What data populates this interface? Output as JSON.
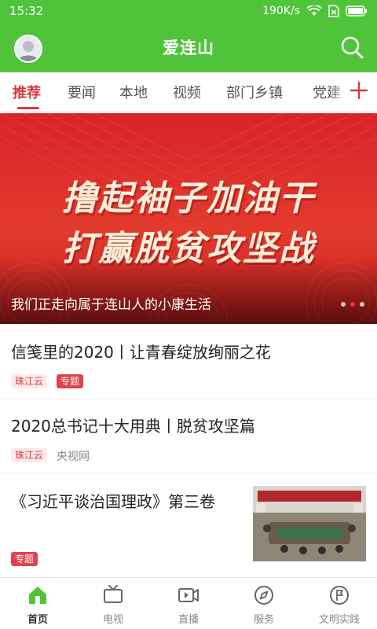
{
  "status_bar": {
    "time": "15:32",
    "speed": "190K/s"
  },
  "header": {
    "title": "爱连山"
  },
  "tabs": [
    {
      "label": "推荐",
      "active": true
    },
    {
      "label": "要闻"
    },
    {
      "label": "本地"
    },
    {
      "label": "视频"
    },
    {
      "label": "部门乡镇"
    },
    {
      "label": "党建"
    }
  ],
  "banner": {
    "headline_line1": "撸起袖子加油干",
    "headline_line2": "打赢脱贫攻坚战",
    "caption": "我们正走向属于连山人的小康生活",
    "pages": 3,
    "active_page": 2
  },
  "news": [
    {
      "title": "信笺里的2020丨让青春绽放绚丽之花",
      "source": "珠江云",
      "tag": "专题"
    },
    {
      "title": "2020总书记十大用典丨脱贫攻坚篇",
      "source": "珠江云",
      "publisher": "央视网"
    },
    {
      "title": "《习近平谈治国理政》第三卷",
      "tag": "专题"
    }
  ],
  "bottom_nav": [
    {
      "label": "首页",
      "icon": "home-icon",
      "active": true
    },
    {
      "label": "电视",
      "icon": "tv-icon"
    },
    {
      "label": "直播",
      "icon": "live-video-icon"
    },
    {
      "label": "服务",
      "icon": "compass-icon"
    },
    {
      "label": "文明实践",
      "icon": "flag-icon"
    }
  ],
  "colors": {
    "brand_green": "#4fc43a",
    "accent_red": "#d93a3a"
  }
}
